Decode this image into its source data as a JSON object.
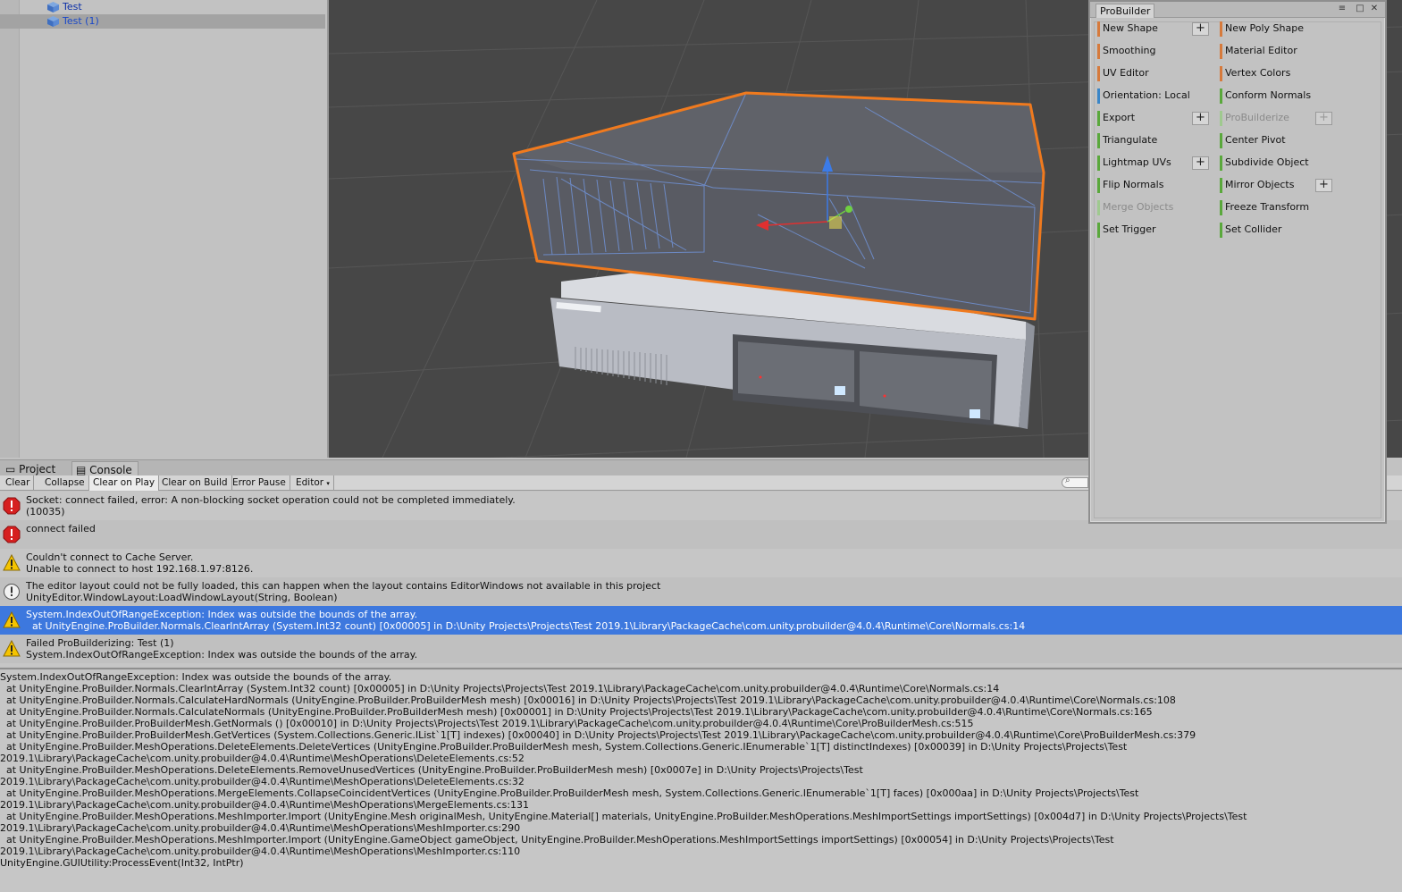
{
  "hierarchy": {
    "items": [
      {
        "label": "Test",
        "selected": false
      },
      {
        "label": "Test (1)",
        "selected": true
      }
    ]
  },
  "probuilder": {
    "title": "ProBuilder",
    "left_column": [
      {
        "label": "New Shape",
        "color": "#d67a3c",
        "has_plus": true,
        "disabled": false
      },
      {
        "label": "Smoothing",
        "color": "#d67a3c",
        "has_plus": false,
        "disabled": false
      },
      {
        "label": "UV Editor",
        "color": "#d67a3c",
        "has_plus": false,
        "disabled": false
      },
      {
        "label": "Orientation: Local",
        "color": "#3a86c8",
        "has_plus": false,
        "disabled": false
      },
      {
        "label": "Export",
        "color": "#5aa83c",
        "has_plus": true,
        "disabled": false
      },
      {
        "label": "Triangulate",
        "color": "#5aa83c",
        "has_plus": false,
        "disabled": false
      },
      {
        "label": "Lightmap UVs",
        "color": "#5aa83c",
        "has_plus": true,
        "disabled": false
      },
      {
        "label": "Flip Normals",
        "color": "#5aa83c",
        "has_plus": false,
        "disabled": false
      },
      {
        "label": "Merge Objects",
        "color": "#9fc98f",
        "has_plus": false,
        "disabled": true
      },
      {
        "label": "Set Trigger",
        "color": "#5aa83c",
        "has_plus": false,
        "disabled": false
      }
    ],
    "right_column": [
      {
        "label": "New Poly Shape",
        "color": "#d67a3c",
        "has_plus": false,
        "disabled": false
      },
      {
        "label": "Material Editor",
        "color": "#d67a3c",
        "has_plus": false,
        "disabled": false
      },
      {
        "label": "Vertex Colors",
        "color": "#d67a3c",
        "has_plus": false,
        "disabled": false
      },
      {
        "label": "Conform Normals",
        "color": "#5aa83c",
        "has_plus": false,
        "disabled": false
      },
      {
        "label": "ProBuilderize",
        "color": "#9fc98f",
        "has_plus": true,
        "disabled": true
      },
      {
        "label": "Center Pivot",
        "color": "#5aa83c",
        "has_plus": false,
        "disabled": false
      },
      {
        "label": "Subdivide Object",
        "color": "#5aa83c",
        "has_plus": false,
        "disabled": false
      },
      {
        "label": "Mirror Objects",
        "color": "#5aa83c",
        "has_plus": true,
        "disabled": false
      },
      {
        "label": "Freeze Transform",
        "color": "#5aa83c",
        "has_plus": false,
        "disabled": false
      },
      {
        "label": "Set Collider",
        "color": "#5aa83c",
        "has_plus": false,
        "disabled": false
      }
    ],
    "plus_symbol": "+"
  },
  "tabs": {
    "project": "Project",
    "console": "Console"
  },
  "toolbar": {
    "clear": "Clear",
    "collapse": "Collapse",
    "clear_on_play": "Clear on Play",
    "clear_on_build": "Clear on Build",
    "error_pause": "Error Pause",
    "editor": "Editor"
  },
  "logs": [
    {
      "type": "error",
      "line1": "Socket: connect failed, error: A non-blocking socket operation could not be completed immediately.",
      "line2": "(10035)",
      "selected": false
    },
    {
      "type": "error",
      "line1": "connect failed",
      "line2": "",
      "selected": false
    },
    {
      "type": "warning",
      "line1": "Couldn't connect to Cache Server.",
      "line2": "Unable to connect to host 192.168.1.97:8126.",
      "selected": false
    },
    {
      "type": "info",
      "line1": "The editor layout could not be fully loaded, this can happen when the layout contains EditorWindows not available in this project",
      "line2": "UnityEditor.WindowLayout:LoadWindowLayout(String, Boolean)",
      "selected": false
    },
    {
      "type": "warning",
      "line1": "System.IndexOutOfRangeException: Index was outside the bounds of the array.",
      "line2": "  at UnityEngine.ProBuilder.Normals.ClearIntArray (System.Int32 count) [0x00005] in D:\\Unity Projects\\Projects\\Test 2019.1\\Library\\PackageCache\\com.unity.probuilder@4.0.4\\Runtime\\Core\\Normals.cs:14",
      "selected": true
    },
    {
      "type": "warning",
      "line1": "Failed ProBuilderizing: Test (1)",
      "line2": "System.IndexOutOfRangeException: Index was outside the bounds of the array.",
      "selected": false
    }
  ],
  "detail_lines": [
    "System.IndexOutOfRangeException: Index was outside the bounds of the array.",
    "  at UnityEngine.ProBuilder.Normals.ClearIntArray (System.Int32 count) [0x00005] in D:\\Unity Projects\\Projects\\Test 2019.1\\Library\\PackageCache\\com.unity.probuilder@4.0.4\\Runtime\\Core\\Normals.cs:14",
    "  at UnityEngine.ProBuilder.Normals.CalculateHardNormals (UnityEngine.ProBuilder.ProBuilderMesh mesh) [0x00016] in D:\\Unity Projects\\Projects\\Test 2019.1\\Library\\PackageCache\\com.unity.probuilder@4.0.4\\Runtime\\Core\\Normals.cs:108",
    "  at UnityEngine.ProBuilder.Normals.CalculateNormals (UnityEngine.ProBuilder.ProBuilderMesh mesh) [0x00001] in D:\\Unity Projects\\Projects\\Test 2019.1\\Library\\PackageCache\\com.unity.probuilder@4.0.4\\Runtime\\Core\\Normals.cs:165",
    "  at UnityEngine.ProBuilder.ProBuilderMesh.GetNormals () [0x00010] in D:\\Unity Projects\\Projects\\Test 2019.1\\Library\\PackageCache\\com.unity.probuilder@4.0.4\\Runtime\\Core\\ProBuilderMesh.cs:515",
    "  at UnityEngine.ProBuilder.ProBuilderMesh.GetVertices (System.Collections.Generic.IList`1[T] indexes) [0x00040] in D:\\Unity Projects\\Projects\\Test 2019.1\\Library\\PackageCache\\com.unity.probuilder@4.0.4\\Runtime\\Core\\ProBuilderMesh.cs:379",
    "  at UnityEngine.ProBuilder.MeshOperations.DeleteElements.DeleteVertices (UnityEngine.ProBuilder.ProBuilderMesh mesh, System.Collections.Generic.IEnumerable`1[T] distinctIndexes) [0x00039] in D:\\Unity Projects\\Projects\\Test",
    "2019.1\\Library\\PackageCache\\com.unity.probuilder@4.0.4\\Runtime\\MeshOperations\\DeleteElements.cs:52",
    "  at UnityEngine.ProBuilder.MeshOperations.DeleteElements.RemoveUnusedVertices (UnityEngine.ProBuilder.ProBuilderMesh mesh) [0x0007e] in D:\\Unity Projects\\Projects\\Test",
    "2019.1\\Library\\PackageCache\\com.unity.probuilder@4.0.4\\Runtime\\MeshOperations\\DeleteElements.cs:32",
    "  at UnityEngine.ProBuilder.MeshOperations.MergeElements.CollapseCoincidentVertices (UnityEngine.ProBuilder.ProBuilderMesh mesh, System.Collections.Generic.IEnumerable`1[T] faces) [0x000aa] in D:\\Unity Projects\\Projects\\Test",
    "2019.1\\Library\\PackageCache\\com.unity.probuilder@4.0.4\\Runtime\\MeshOperations\\MergeElements.cs:131",
    "  at UnityEngine.ProBuilder.MeshOperations.MeshImporter.Import (UnityEngine.Mesh originalMesh, UnityEngine.Material[] materials, UnityEngine.ProBuilder.MeshOperations.MeshImportSettings importSettings) [0x004d7] in D:\\Unity Projects\\Projects\\Test",
    "2019.1\\Library\\PackageCache\\com.unity.probuilder@4.0.4\\Runtime\\MeshOperations\\MeshImporter.cs:290",
    "  at UnityEngine.ProBuilder.MeshOperations.MeshImporter.Import (UnityEngine.GameObject gameObject, UnityEngine.ProBuilder.MeshOperations.MeshImportSettings importSettings) [0x00054] in D:\\Unity Projects\\Projects\\Test",
    "2019.1\\Library\\PackageCache\\com.unity.probuilder@4.0.4\\Runtime\\MeshOperations\\MeshImporter.cs:110",
    "UnityEngine.GUIUtility:ProcessEvent(Int32, IntPtr)"
  ],
  "colors": {
    "selection_blue": "#3d78de",
    "scene_bg": "#474747",
    "selection_outline": "#f07a1e",
    "wireframe": "#6f8fcf"
  }
}
